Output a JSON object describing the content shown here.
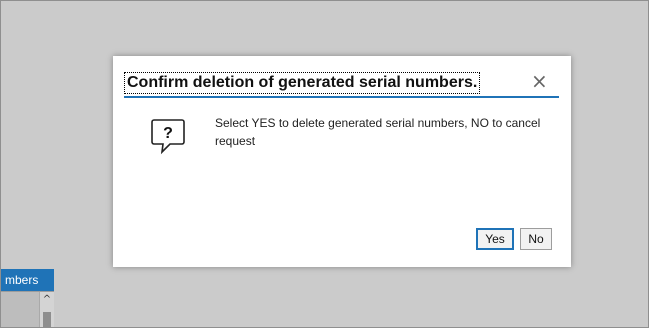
{
  "background": {
    "tab_label": "mbers",
    "scroll_up_glyph": "^"
  },
  "dialog": {
    "title": "Confirm deletion of generated serial numbers.",
    "close_glyph": "×",
    "icon": "question-icon",
    "icon_glyph": "?",
    "message": "Select YES to delete generated serial numbers, NO to cancel request",
    "yes_label": "Yes",
    "no_label": "No"
  },
  "colors": {
    "accent": "#1f73b7",
    "backdrop": "#c9c9c9",
    "dialog_bg": "#ffffff"
  }
}
